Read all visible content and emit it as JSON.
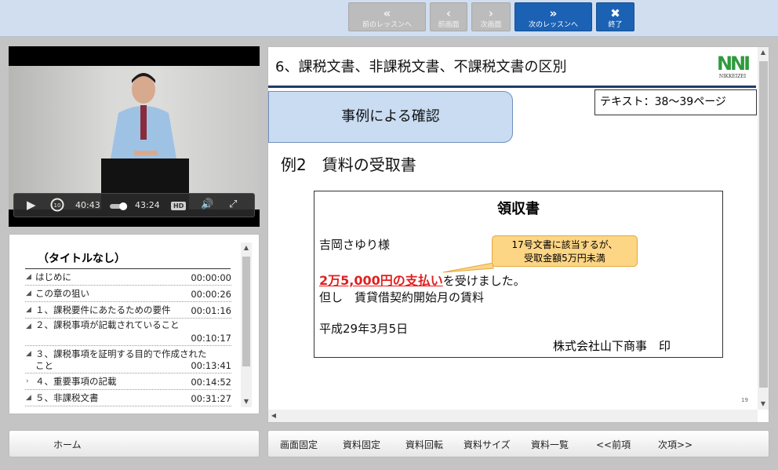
{
  "nav": {
    "prev_lesson": "前のレッスンへ",
    "prev_screen": "前画面",
    "next_screen": "次画面",
    "next_lesson": "次のレッスンへ",
    "close": "終了"
  },
  "video": {
    "current_time": "40:43",
    "duration": "43:24",
    "hd": "HD",
    "progress": 0.938
  },
  "playlist": {
    "title": "（タイトルなし）",
    "items": [
      {
        "title": "はじめに",
        "time": "00:00:00"
      },
      {
        "title": "この章の狙い",
        "time": "00:00:26"
      },
      {
        "title": "１、課税要件にあたるための要件",
        "time": "00:01:16"
      },
      {
        "title": "２、課税事項が記載されていること",
        "time": "00:10:17"
      },
      {
        "title": "３、課税事項を証明する目的で作成されたこと",
        "time": "00:13:41"
      },
      {
        "title": "４、重要事項の記載",
        "time": "00:14:52"
      },
      {
        "title": "５、非課税文書",
        "time": "00:31:27"
      }
    ]
  },
  "slide": {
    "heading": "6、課税文書、非課税文書、不課税文書の区別",
    "logo_text": "NIKKEIZEI",
    "section_label": "事例による確認",
    "text_ref": "テキスト：38〜39ページ",
    "example_title": "例2　賃料の受取書",
    "receipt": {
      "title": "領収書",
      "recipient": "吉岡さゆり様",
      "amount": "2万5,000円の支払い",
      "amount_suffix": "を受けました。",
      "note": "但し　賃貸借契約開始月の賃料",
      "date": "平成29年3月5日",
      "company": "株式会社山下商事　印"
    },
    "callout": {
      "line1": "17号文書に該当するが、",
      "line2": "受取金額5万円未満"
    },
    "page_number": "19"
  },
  "footer": {
    "home": "ホーム",
    "tools": [
      "画面固定",
      "資料固定",
      "資料回転",
      "資料サイズ",
      "資料一覧",
      "<<前項",
      "次項>>"
    ]
  },
  "colors": {
    "accent_blue": "#1c62b4",
    "amount_red": "#e02020",
    "callout_fill": "#fcd585",
    "section_fill": "#c9dcf2"
  }
}
